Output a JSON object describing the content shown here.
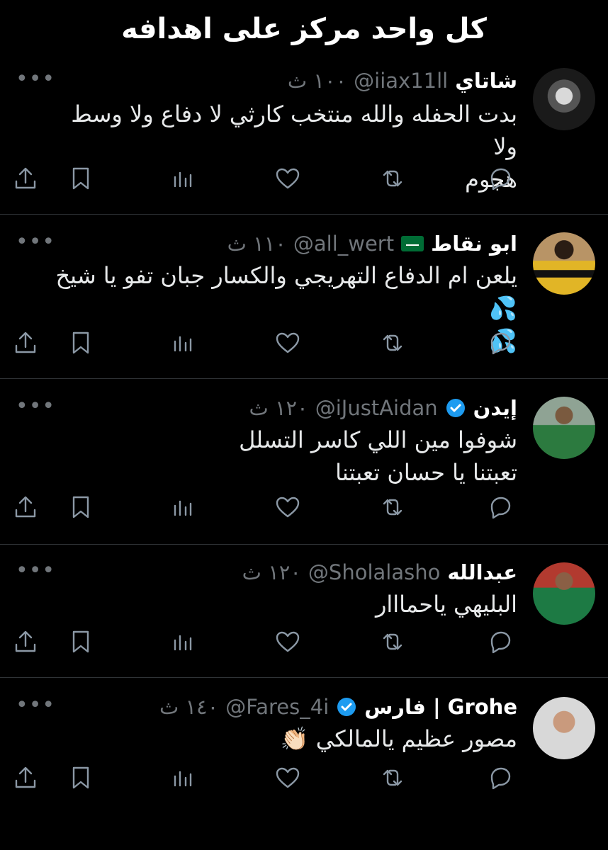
{
  "caption": "كل واحد مركز على اهدافه",
  "tweets": [
    {
      "name": "شاتاي",
      "handle": "@iiax11ll",
      "time": "١٠٠ ث",
      "verified": false,
      "flag": false,
      "text_line1": "بدت الحفله والله منتخب كارثي لا دفاع ولا وسط ولا",
      "text_line2": "هجوم",
      "more": "•••"
    },
    {
      "name": "ابو نقاط",
      "handle": "@all_wert",
      "time": "١١٠ ث",
      "verified": false,
      "flag": true,
      "text_line1": "يلعن ام الدفاع التهريجي والكسار جبان تفو يا شيخ 💦",
      "text_line2": "💦",
      "more": "•••"
    },
    {
      "name": "إيدن",
      "handle": "@iJustAidan",
      "time": "١٢٠ ث",
      "verified": true,
      "flag": false,
      "text_line1": "شوفوا مين اللي كاسر التسلل",
      "text_line2": "تعبتنا يا حسان تعبتنا",
      "more": "•••"
    },
    {
      "name": "عبدالله",
      "handle": "@Sholalasho",
      "time": "١٢٠ ث",
      "verified": false,
      "flag": false,
      "text_line1": "البليهي ياحمااار",
      "text_line2": "",
      "more": "•••"
    },
    {
      "name": "فارس | Grohe",
      "handle": "@Fares_4i",
      "time": "١٤٠ ث",
      "verified": true,
      "flag": false,
      "text_line1": "مصور عظيم يالمالكي 👏🏻",
      "text_line2": "",
      "more": "•••"
    }
  ],
  "icons": {
    "reply": "reply-icon",
    "retweet": "retweet-icon",
    "like": "heart-icon",
    "views": "views-icon",
    "bookmark": "bookmark-icon",
    "share": "share-icon"
  },
  "colors": {
    "background": "#000000",
    "text": "#e7e9ea",
    "secondary": "#71767b",
    "verified": "#1d9bf0",
    "flag": "#006c35"
  }
}
